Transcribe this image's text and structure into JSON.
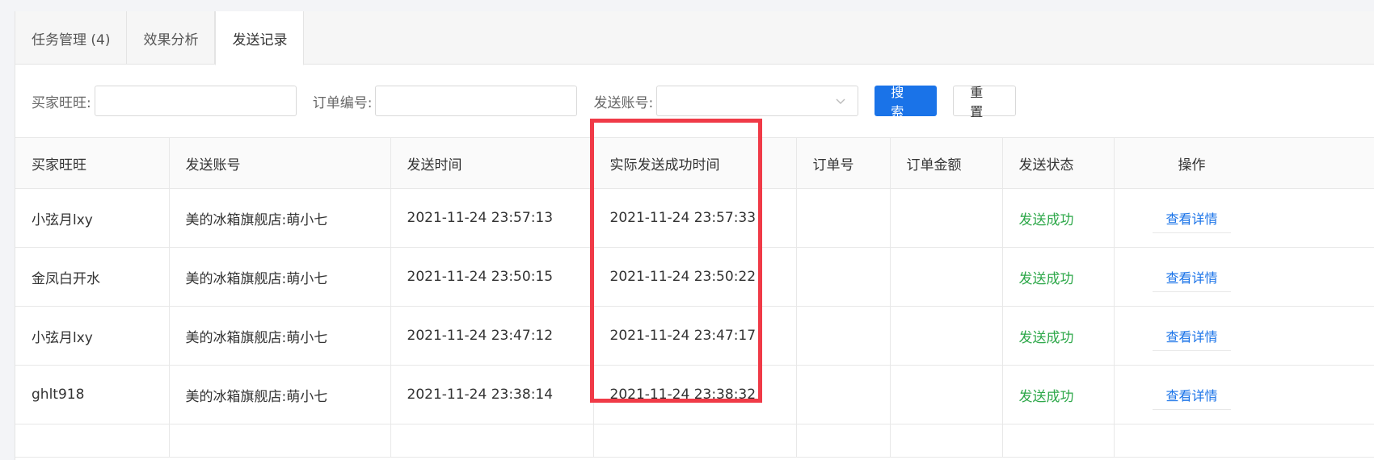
{
  "tabs": [
    {
      "label": "任务管理 (4)"
    },
    {
      "label": "效果分析"
    },
    {
      "label": "发送记录"
    }
  ],
  "filters": {
    "buyer_label": "买家旺旺:",
    "buyer_value": "",
    "order_label": "订单编号:",
    "order_value": "",
    "account_label": "发送账号:",
    "account_value": "",
    "search_label": "搜索",
    "reset_label": "重置"
  },
  "table": {
    "headers": [
      "买家旺旺",
      "发送账号",
      "发送时间",
      "实际发送成功时间",
      "订单号",
      "订单金额",
      "发送状态",
      "操作"
    ],
    "rows": [
      {
        "buyer": "小弦月lxy",
        "account": "美的冰箱旗舰店:萌小七",
        "send_time": "2021-11-24 23:57:13",
        "success_time": "2021-11-24 23:57:33",
        "order_no": "",
        "amount": "",
        "status": "发送成功",
        "action": "查看详情"
      },
      {
        "buyer": "金凤白开水",
        "account": "美的冰箱旗舰店:萌小七",
        "send_time": "2021-11-24 23:50:15",
        "success_time": "2021-11-24 23:50:22",
        "order_no": "",
        "amount": "",
        "status": "发送成功",
        "action": "查看详情"
      },
      {
        "buyer": "小弦月lxy",
        "account": "美的冰箱旗舰店:萌小七",
        "send_time": "2021-11-24 23:47:12",
        "success_time": "2021-11-24 23:47:17",
        "order_no": "",
        "amount": "",
        "status": "发送成功",
        "action": "查看详情"
      },
      {
        "buyer": "ghlt918",
        "account": "美的冰箱旗舰店:萌小七",
        "send_time": "2021-11-24 23:38:14",
        "success_time": "2021-11-24 23:38:32",
        "order_no": "",
        "amount": "",
        "status": "发送成功",
        "action": "查看详情"
      }
    ]
  },
  "colors": {
    "primary": "#1a73e8",
    "success": "#2ea84a",
    "highlight": "#f03a47"
  },
  "icons": {
    "account_select": "chevron-down-icon"
  }
}
